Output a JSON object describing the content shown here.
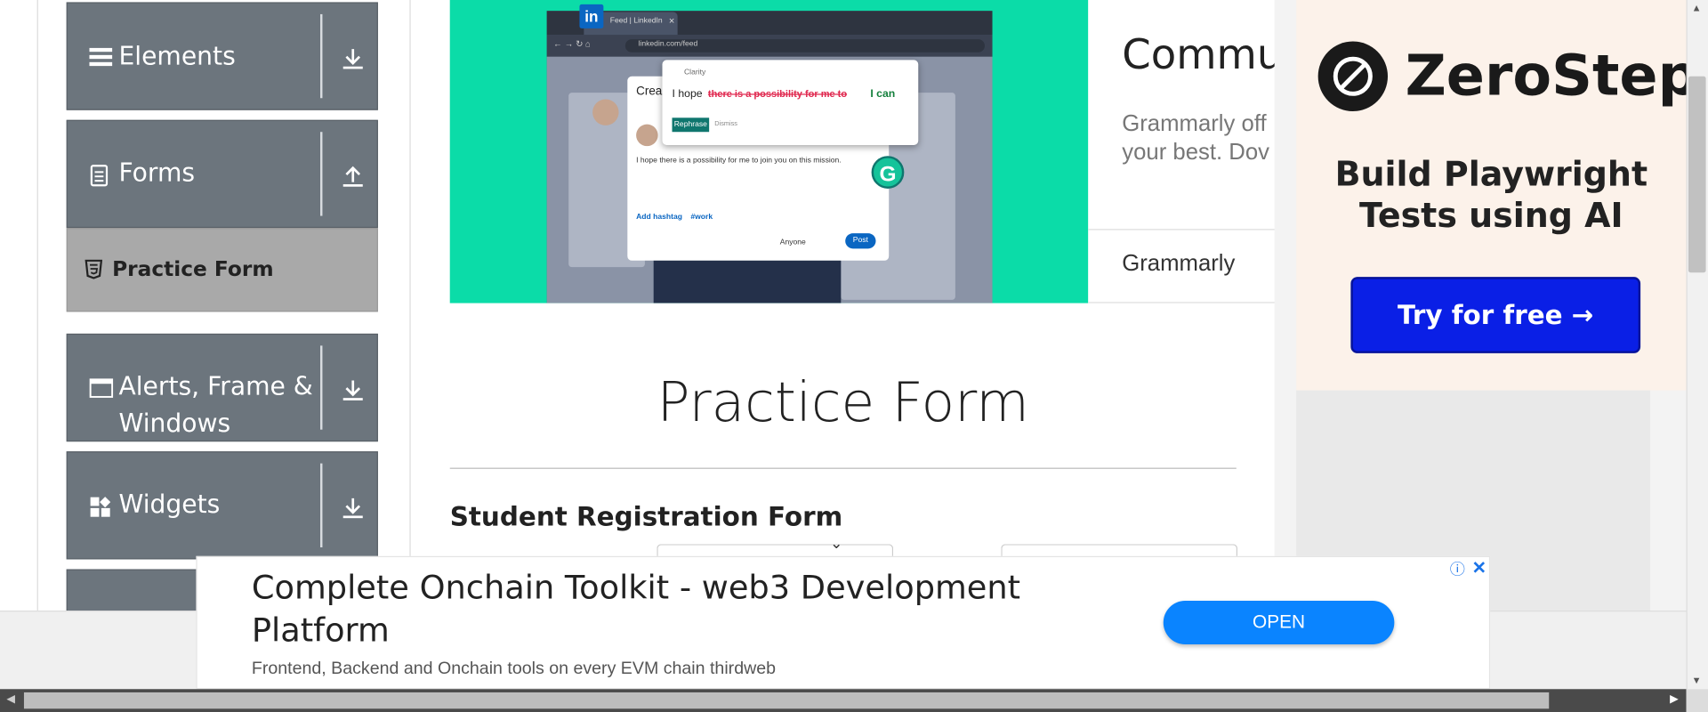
{
  "sidebar": {
    "groups": [
      {
        "label": "Elements",
        "icon": "hamburger-icon",
        "arrow": "download-arrow-icon"
      },
      {
        "label": "Forms",
        "icon": "document-icon",
        "arrow": "upload-arrow-icon"
      },
      {
        "label": "Alerts, Frame &",
        "label2": "Windows",
        "icon": "window-icon",
        "arrow": "download-arrow-icon"
      },
      {
        "label": "Widgets",
        "icon": "widgets-icon",
        "arrow": "download-arrow-icon"
      }
    ],
    "sub_item": "Practice Form"
  },
  "ad_image": {
    "tab_title": "Feed | LinkedIn",
    "url": "linkedin.com/feed",
    "popup_brand": "Clarity",
    "popup_text_prefix": "I hope",
    "popup_strike": "there is a possibility for me to",
    "popup_correct": "I can",
    "rephrase": "Rephrase",
    "dismiss": "Dismiss",
    "post_text": "I hope there is a possibility for me to join you on this mission.",
    "add_hashtag": "Add hashtag",
    "hashtag": "#work",
    "anyone": "Anyone",
    "post": "Post",
    "create": "Crea"
  },
  "grammarly_card": {
    "heading": "Commun",
    "desc1": "Grammarly off",
    "desc2": "your best. Dov",
    "brand": "Grammarly"
  },
  "zerostep": {
    "logo_text": "ZeroStep",
    "line1": "Build Playwright",
    "line2": "Tests using AI",
    "cta": "Try for free →"
  },
  "main": {
    "title": "Practice Form",
    "form_title": "Student Registration Form"
  },
  "banner": {
    "title1": "Complete Onchain Toolkit - web3 Development",
    "title2": "Platform",
    "desc": "Frontend, Backend and Onchain tools on every EVM chain thirdweb",
    "open": "OPEN"
  },
  "colors": {
    "sidebar_bg": "#6c757d",
    "sub_item_bg": "#a9a9a9",
    "ad_green": "#0bdca8",
    "cta_blue": "#0a1fe6",
    "open_blue": "#0a84ff"
  }
}
